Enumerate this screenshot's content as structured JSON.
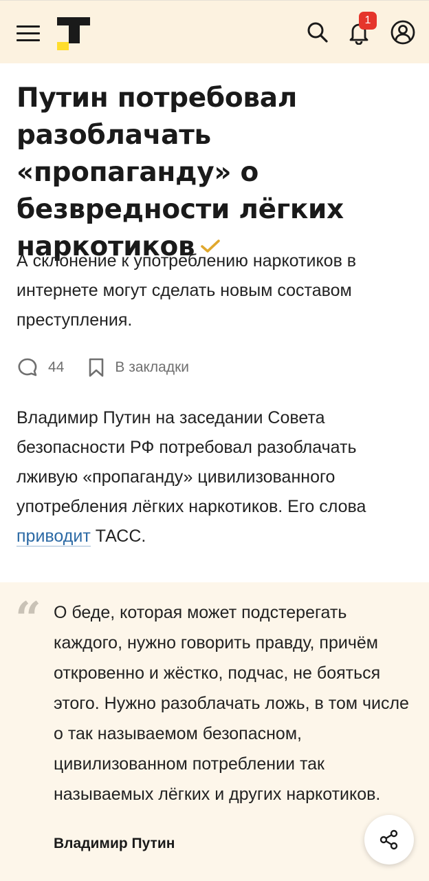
{
  "header": {
    "menu_icon": "hamburger-icon",
    "logo_icon": "tinkoff-journal-logo",
    "search_icon": "search-icon",
    "notifications_icon": "bell-icon",
    "notifications_count": "1",
    "profile_icon": "user-icon",
    "badge_color": "#e5352b",
    "brand_color": "#ffdd2d"
  },
  "article": {
    "title": "Путин потребовал разоблачать «пропаганду» о безвредности лёгких наркотиков",
    "verified_icon": "checkmark-icon",
    "lead": "А склонение к употреблению наркотиков в интернете могут сделать новым составом преступления.",
    "comments_count": "44",
    "bookmark_label": "В закладки",
    "body_before_link": "Владимир Путин на заседании Совета безопасности РФ потребовал разоблачать лживую «пропаганду» цивилизованного употребления лёгких наркотиков. Его слова ",
    "body_link": "приводит",
    "body_after_link": " ТАСС.",
    "link_color": "#2c6aa5"
  },
  "quote": {
    "mark": "“",
    "text": "О беде, которая может подстерегать каждого, нужно говорить правду, причём откровенно и жёстко, подчас, не бояться этого. Нужно разоблачать ложь, в том числе о так называемом безопасном, цивилизованном потреблении так называемых лёгких и других наркотиков.",
    "author": "Владимир Путин"
  },
  "share_icon": "share-icon"
}
